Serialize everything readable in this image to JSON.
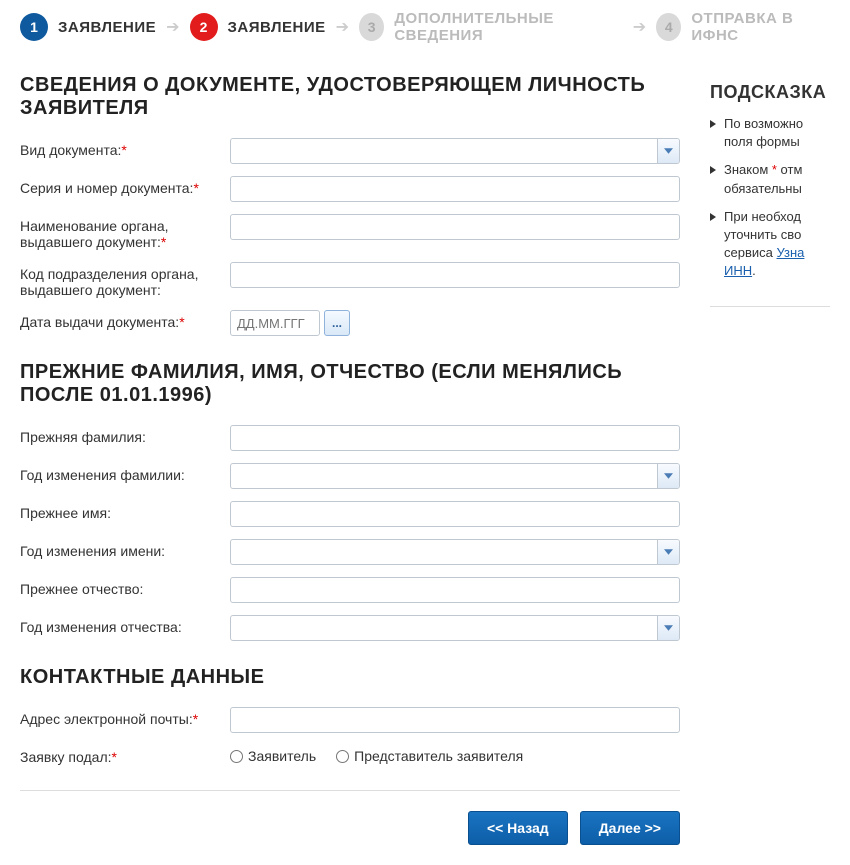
{
  "stepper": {
    "steps": [
      {
        "num": "1",
        "label": "ЗАЯВЛЕНИЕ"
      },
      {
        "num": "2",
        "label": "ЗАЯВЛЕНИЕ"
      },
      {
        "num": "3",
        "label": "ДОПОЛНИТЕЛЬНЫЕ СВЕДЕНИЯ"
      },
      {
        "num": "4",
        "label": "ОТПРАВКА В ИФНС"
      }
    ]
  },
  "sections": {
    "doc": {
      "title": "СВЕДЕНИЯ О ДОКУМЕНТЕ, УДОСТОВЕРЯЮЩЕМ ЛИЧНОСТЬ ЗАЯВИТЕЛЯ",
      "fields": {
        "kind_label": "Вид документа:",
        "series_label": "Серия и номер документа:",
        "issuer_label": "Наименование органа, выдавшего документ:",
        "code_label": "Код подразделения органа, выдавшего документ:",
        "date_label": "Дата выдачи документа:",
        "date_placeholder": "ДД.ММ.ГГГ",
        "date_btn": "..."
      }
    },
    "prev_names": {
      "title": "ПРЕЖНИЕ ФАМИЛИЯ, ИМЯ, ОТЧЕСТВО (ЕСЛИ МЕНЯЛИСЬ ПОСЛЕ 01.01.1996)",
      "fields": {
        "prev_surname": "Прежняя фамилия:",
        "year_surname": "Год изменения фамилии:",
        "prev_name": "Прежнее имя:",
        "year_name": "Год изменения имени:",
        "prev_patronymic": "Прежнее отчество:",
        "year_patronymic": "Год изменения отчества:"
      }
    },
    "contact": {
      "title": "КОНТАКТНЫЕ ДАННЫЕ",
      "email_label": "Адрес электронной почты:",
      "submitter_label": "Заявку подал:",
      "radio_applicant": "Заявитель",
      "radio_rep": "Представитель заявителя"
    }
  },
  "buttons": {
    "back": "<< Назад",
    "next": "Далее >>"
  },
  "sidebar": {
    "title": "ПОДСКАЗКА",
    "tips": {
      "t1_a": "По возможно",
      "t1_b": "поля формы",
      "t2_a": "Знаком ",
      "t2_star": "*",
      "t2_b": " отм",
      "t2_c": "обязательны",
      "t3_a": "При необход",
      "t3_b": "уточнить сво",
      "t3_c": "сервиса ",
      "t3_link1": "Узна",
      "t3_link2": "ИНН",
      "t3_d": "."
    }
  }
}
